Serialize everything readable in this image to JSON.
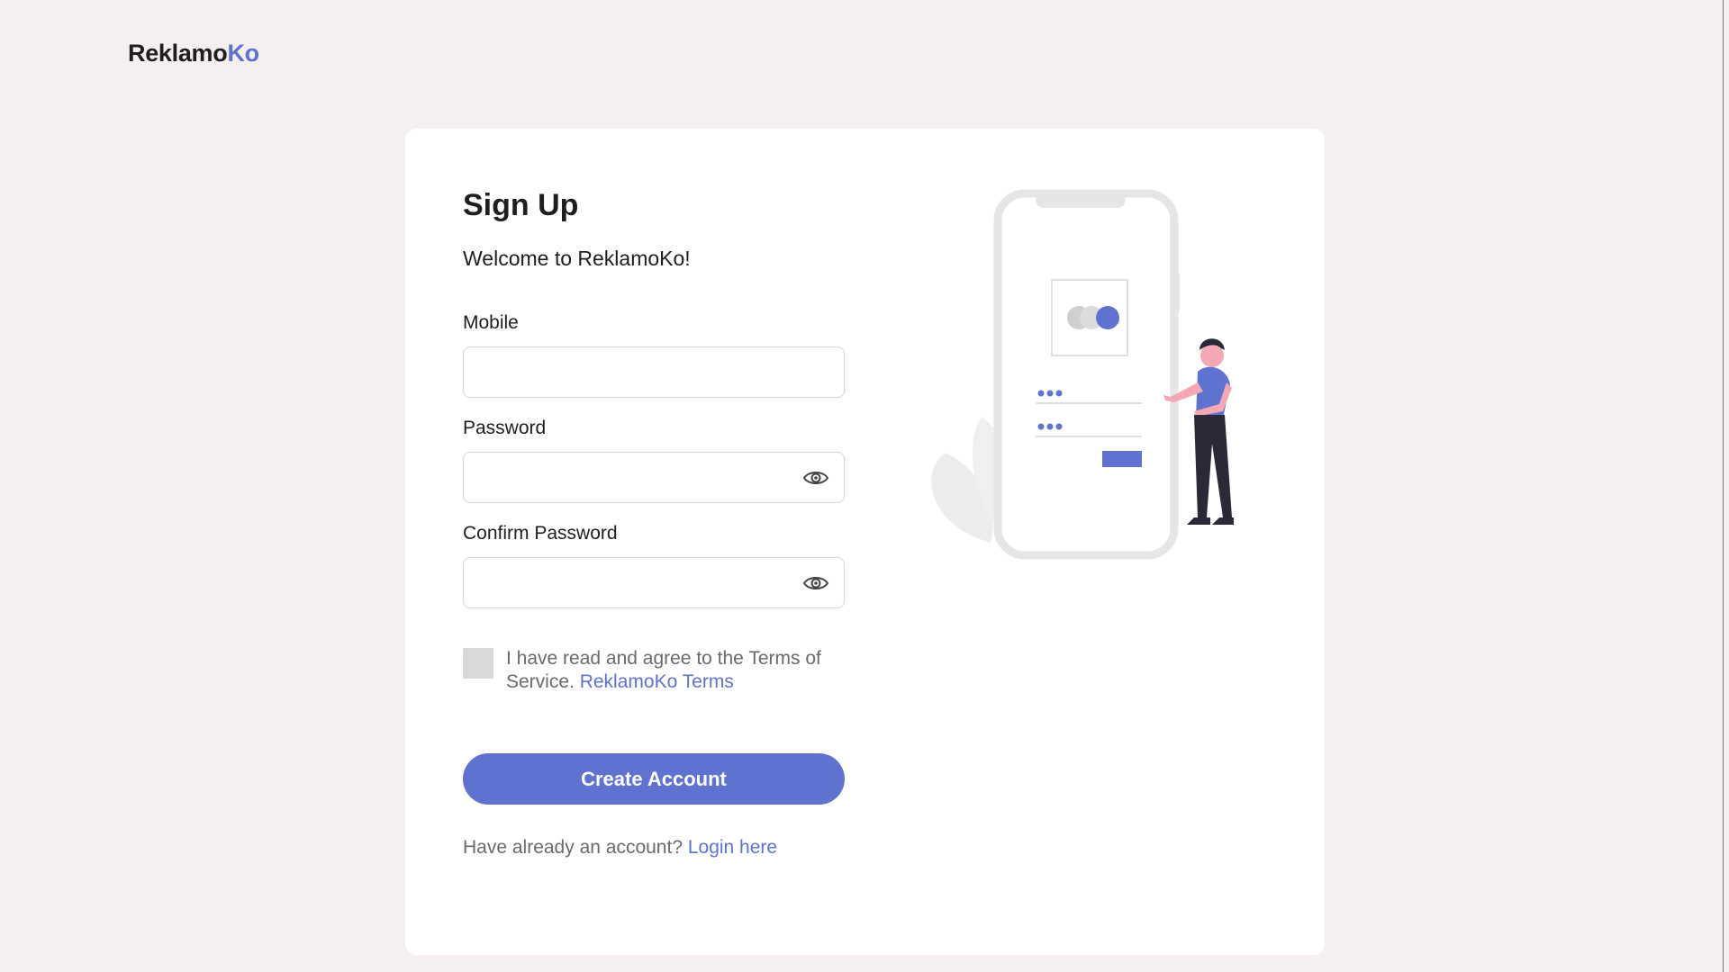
{
  "brand": {
    "part1": "Reklamo",
    "part2": "Ko"
  },
  "colors": {
    "accent": "#5e73cf",
    "background": "#f5efef",
    "card": "#ffffff"
  },
  "form": {
    "title": "Sign Up",
    "welcome": "Welcome to ReklamoKo!",
    "mobile_label": "Mobile",
    "mobile_value": "",
    "password_label": "Password",
    "password_value": "",
    "confirm_label": "Confirm Password",
    "confirm_value": "",
    "terms_text": "I have read and agree to the Terms of Service.",
    "terms_link": "ReklamoKo Terms",
    "terms_checked": false,
    "submit_label": "Create Account",
    "login_prompt": "Have already an account?",
    "login_link": "Login here"
  },
  "icons": {
    "password_toggle": "eye-icon",
    "confirm_toggle": "eye-icon"
  }
}
